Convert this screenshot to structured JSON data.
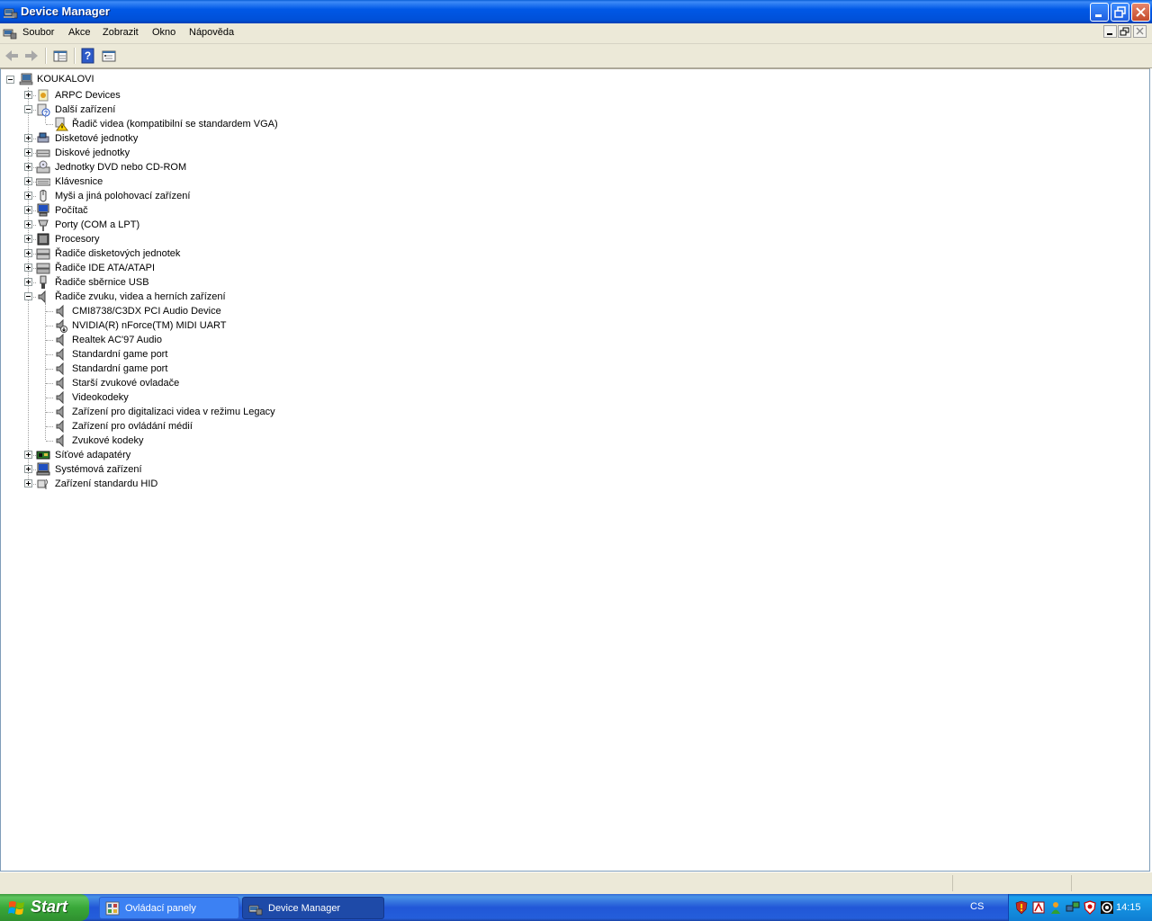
{
  "window": {
    "title": "Device Manager"
  },
  "menubar": {
    "items": [
      "Soubor",
      "Akce",
      "Zobrazit",
      "Okno",
      "Nápověda"
    ]
  },
  "tree": {
    "root": "KOUKALOVI",
    "categories": [
      {
        "label": "ARPC Devices",
        "icon": "arpc-device-icon",
        "expanded": false
      },
      {
        "label": "Další zařízení",
        "icon": "unknown-device-icon",
        "expanded": true,
        "children": [
          {
            "label": "Řadič videa (kompatibilní se standardem VGA)",
            "icon": "warning-device-icon"
          }
        ]
      },
      {
        "label": "Disketové jednotky",
        "icon": "floppy-drive-icon",
        "expanded": false
      },
      {
        "label": "Diskové jednotky",
        "icon": "disk-drive-icon",
        "expanded": false
      },
      {
        "label": "Jednotky DVD nebo CD-ROM",
        "icon": "cdrom-icon",
        "expanded": false
      },
      {
        "label": "Klávesnice",
        "icon": "keyboard-icon",
        "expanded": false
      },
      {
        "label": "Myši a jiná polohovací zařízení",
        "icon": "mouse-icon",
        "expanded": false
      },
      {
        "label": "Počítač",
        "icon": "computer-icon",
        "expanded": false
      },
      {
        "label": "Porty (COM a LPT)",
        "icon": "port-icon",
        "expanded": false
      },
      {
        "label": "Procesory",
        "icon": "processor-icon",
        "expanded": false
      },
      {
        "label": "Řadiče disketových jednotek",
        "icon": "floppy-controller-icon",
        "expanded": false
      },
      {
        "label": "Řadiče IDE ATA/ATAPI",
        "icon": "ide-controller-icon",
        "expanded": false
      },
      {
        "label": "Řadiče sběrnice USB",
        "icon": "usb-icon",
        "expanded": false
      },
      {
        "label": "Řadiče zvuku, videa a herních zařízení",
        "icon": "speaker-icon",
        "expanded": true,
        "children": [
          {
            "label": "CMI8738/C3DX PCI Audio Device",
            "icon": "speaker-icon"
          },
          {
            "label": "NVIDIA(R) nForce(TM) MIDI UART",
            "icon": "disabled-speaker-icon"
          },
          {
            "label": "Realtek AC'97 Audio",
            "icon": "speaker-icon"
          },
          {
            "label": "Standardní game port",
            "icon": "speaker-icon"
          },
          {
            "label": "Standardní game port",
            "icon": "speaker-icon"
          },
          {
            "label": "Starší zvukové ovladače",
            "icon": "speaker-icon"
          },
          {
            "label": "Videokodeky",
            "icon": "speaker-icon"
          },
          {
            "label": "Zařízení pro digitalizaci videa v režimu Legacy",
            "icon": "speaker-icon"
          },
          {
            "label": "Zařízení pro ovládání médií",
            "icon": "speaker-icon"
          },
          {
            "label": "Zvukové kodeky",
            "icon": "speaker-icon"
          }
        ]
      },
      {
        "label": "Síťové adapatéry",
        "icon": "network-card-icon",
        "expanded": false
      },
      {
        "label": "Systémová zařízení",
        "icon": "system-device-icon",
        "expanded": false
      },
      {
        "label": "Zařízení standardu HID",
        "icon": "hid-icon",
        "expanded": false
      }
    ]
  },
  "taskbar": {
    "start_label": "Start",
    "buttons": [
      {
        "label": "Ovládací panely",
        "active": false
      },
      {
        "label": "Device Manager",
        "active": true
      }
    ],
    "language": "CS",
    "clock": "14:15"
  }
}
